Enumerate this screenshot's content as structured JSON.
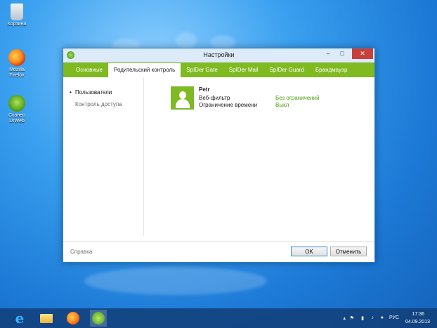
{
  "desktop": {
    "icons": [
      {
        "label": "Корзина",
        "icon": "recycle-bin-icon"
      },
      {
        "label": "Mozilla Firefox",
        "icon": "firefox-icon"
      },
      {
        "label": "Сканер DrWeb",
        "icon": "drweb-scanner-icon"
      }
    ]
  },
  "window": {
    "title": "Настройки",
    "controls": {
      "minimize": "–",
      "maximize": "□",
      "close": "✕"
    },
    "tabs": [
      {
        "label": "Основные",
        "active": false
      },
      {
        "label": "Родительский контроль",
        "active": true
      },
      {
        "label": "SpIDer Gate",
        "active": false
      },
      {
        "label": "SpIDer Mail",
        "active": false
      },
      {
        "label": "SpIDer Guard",
        "active": false
      },
      {
        "label": "Брандмауэр",
        "active": false
      }
    ],
    "nav": [
      {
        "label": "Пользователи",
        "active": true
      },
      {
        "label": "Контроль доступа",
        "active": false
      }
    ],
    "user": {
      "name": "Petr",
      "web_filter_label": "Веб-фильтр",
      "web_filter_value": "Без ограничений",
      "time_limit_label": "Ограничение времени",
      "time_limit_value": "Выкл"
    },
    "footer": {
      "help": "Справка",
      "ok": "OK",
      "cancel": "Отменить"
    },
    "accent_color": "#7fba21"
  },
  "taskbar": {
    "items": [
      "internet-explorer-icon",
      "file-explorer-icon",
      "firefox-icon",
      "drweb-icon"
    ],
    "tray": {
      "language": "РУС",
      "time": "17:36",
      "date": "04.09.2013"
    }
  }
}
